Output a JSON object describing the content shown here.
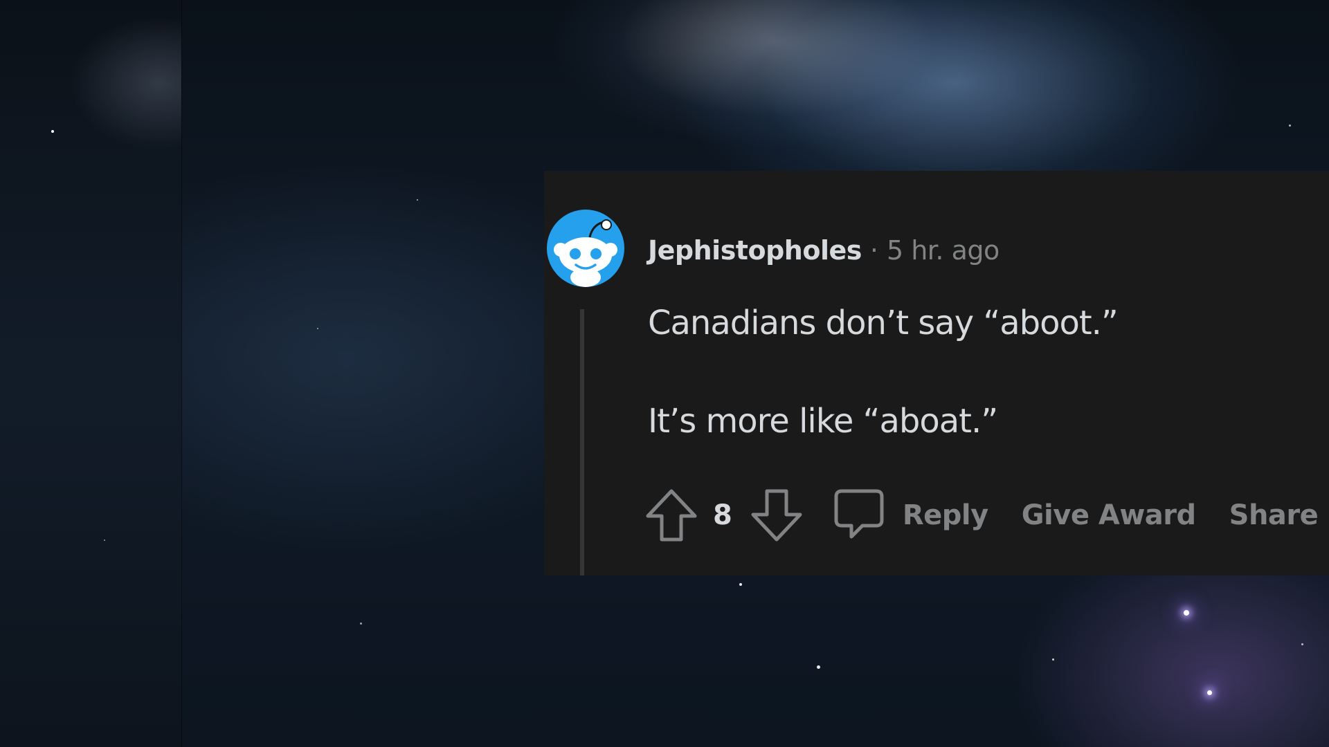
{
  "comment": {
    "username": "Jephistopholes",
    "separator": "·",
    "timestamp": "5 hr. ago",
    "body": [
      "Canadians don’t say “aboot.”",
      "It’s more like “aboat.”"
    ],
    "score": "8"
  },
  "actions": {
    "reply_label": "Reply",
    "award_label": "Give Award",
    "share_label": "Share"
  },
  "icons": {
    "avatar": "snoo-avatar-icon",
    "upvote": "upvote-arrow-icon",
    "downvote": "downvote-arrow-icon",
    "reply": "speech-bubble-icon"
  },
  "colors": {
    "card_background": "#1a1a1b",
    "primary_text": "#d7dadc",
    "secondary_text": "#818384",
    "avatar_blue": "#24a0ed"
  }
}
